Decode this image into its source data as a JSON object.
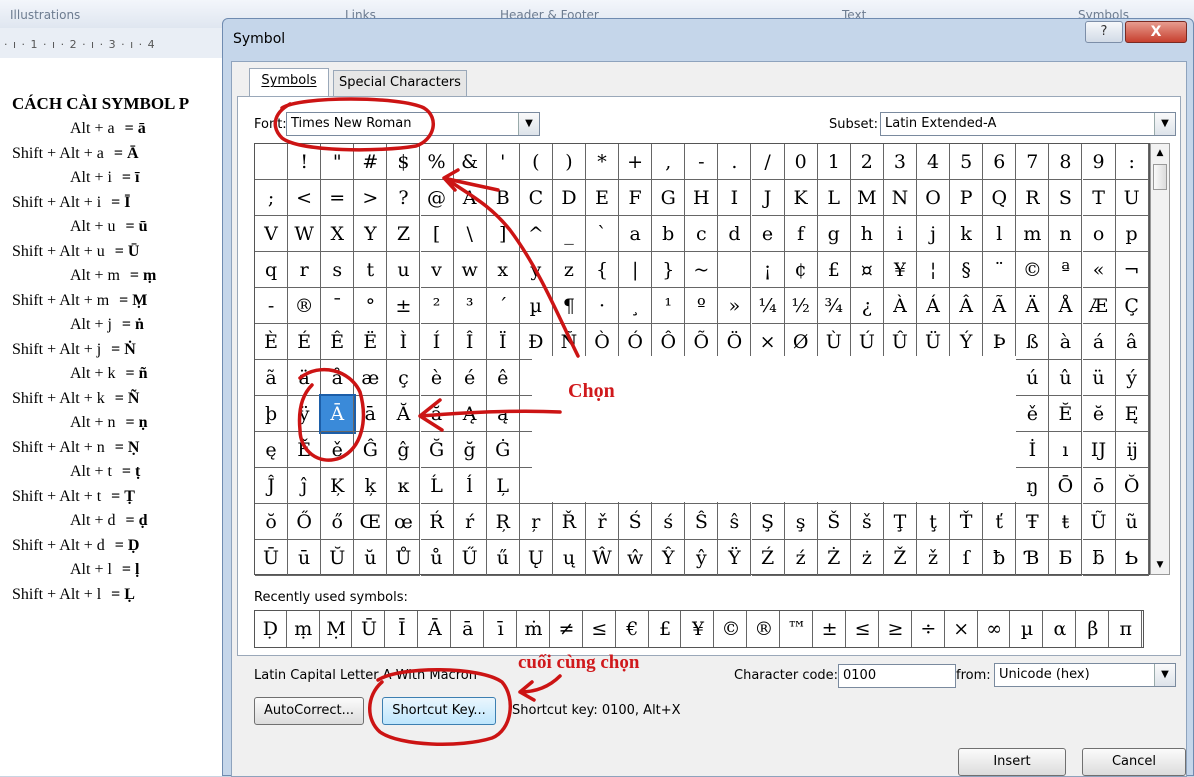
{
  "background": {
    "ribbon_groups": [
      "Illustrations",
      "Links",
      "Header & Footer",
      "Text",
      "Symbols"
    ],
    "ruler_text": "· ı · 1 · ı · 2 · ı · 3 · ı · 4",
    "doc_title": "CÁCH CÀI SYMBOL P",
    "doc_lines": [
      {
        "keys": "Alt + a",
        "sym": "= ā"
      },
      {
        "keys": "Shift + Alt + a",
        "sym": "= Ā"
      },
      {
        "keys": "Alt + i",
        "sym": "= ī"
      },
      {
        "keys": "Shift + Alt + i",
        "sym": "= Ī"
      },
      {
        "keys": "Alt + u",
        "sym": "= ū"
      },
      {
        "keys": "Shift + Alt + u",
        "sym": "= Ū"
      },
      {
        "keys": "Alt + m",
        "sym": "= ṃ"
      },
      {
        "keys": "Shift + Alt + m",
        "sym": "= Ṃ"
      },
      {
        "keys": "Alt + j",
        "sym": "= ṅ"
      },
      {
        "keys": "Shift + Alt + j",
        "sym": "= Ṅ"
      },
      {
        "keys": "Alt + k",
        "sym": "= ñ"
      },
      {
        "keys": "Shift + Alt + k",
        "sym": "= Ñ"
      },
      {
        "keys": "Alt + n",
        "sym": "= ṇ"
      },
      {
        "keys": "Shift + Alt + n",
        "sym": "= Ṇ"
      },
      {
        "keys": "Alt + t",
        "sym": "= ṭ"
      },
      {
        "keys": "Shift + Alt + t",
        "sym": "= Ṭ"
      },
      {
        "keys": "Alt + d",
        "sym": "= ḍ"
      },
      {
        "keys": "Shift + Alt + d",
        "sym": "= Ḍ"
      },
      {
        "keys": "Alt + l",
        "sym": "= ḷ"
      },
      {
        "keys": "Shift + Alt + l",
        "sym": "= Ḷ"
      }
    ]
  },
  "dialog": {
    "title": "Symbol",
    "help_label": "?",
    "close_label": "X",
    "tabs": [
      "Symbols",
      "Special Characters"
    ],
    "font_label": "Font:",
    "font_value": "Times New Roman",
    "subset_label": "Subset:",
    "subset_value": "Latin Extended-A",
    "grid_rows": [
      [
        " ",
        "!",
        "\"",
        "#",
        "$",
        "%",
        "&",
        "'",
        "(",
        ")",
        "*",
        "+",
        ",",
        "-",
        ".",
        "/",
        "0",
        "1",
        "2",
        "3",
        "4",
        "5",
        "6",
        "7",
        "8",
        "9",
        ":"
      ],
      [
        ";",
        "<",
        "=",
        ">",
        "?",
        "@",
        "A",
        "B",
        "C",
        "D",
        "E",
        "F",
        "G",
        "H",
        "I",
        "J",
        "K",
        "L",
        "M",
        "N",
        "O",
        "P",
        "Q",
        "R",
        "S",
        "T",
        "U"
      ],
      [
        "V",
        "W",
        "X",
        "Y",
        "Z",
        "[",
        "\\",
        "]",
        "^",
        "_",
        "`",
        "a",
        "b",
        "c",
        "d",
        "e",
        "f",
        "g",
        "h",
        "i",
        "j",
        "k",
        "l",
        "m",
        "n",
        "o",
        "p"
      ],
      [
        "q",
        "r",
        "s",
        "t",
        "u",
        "v",
        "w",
        "x",
        "y",
        "z",
        "{",
        "|",
        "}",
        "~",
        " ",
        "¡",
        "¢",
        "£",
        "¤",
        "¥",
        "¦",
        "§",
        "¨",
        "©",
        "ª",
        "«",
        "¬"
      ],
      [
        "-",
        "®",
        "¯",
        "°",
        "±",
        "²",
        "³",
        "´",
        "µ",
        "¶",
        "·",
        "¸",
        "¹",
        "º",
        "»",
        "¼",
        "½",
        "¾",
        "¿",
        "À",
        "Á",
        "Â",
        "Ã",
        "Ä",
        "Å",
        "Æ",
        "Ç"
      ],
      [
        "È",
        "É",
        "Ê",
        "Ë",
        "Ì",
        "Í",
        "Î",
        "Ï",
        "Ð",
        "Ñ",
        "Ò",
        "Ó",
        "Ô",
        "Õ",
        "Ö",
        "×",
        "Ø",
        "Ù",
        "Ú",
        "Û",
        "Ü",
        "Ý",
        "Þ",
        "ß",
        "à",
        "á",
        "â"
      ],
      [
        "ã",
        "ä",
        "å",
        "æ",
        "ç",
        "è",
        "é",
        "ê",
        "",
        "",
        "",
        "",
        "",
        "",
        "",
        "",
        "",
        "",
        "",
        "",
        "",
        "",
        "",
        "ú",
        "û",
        "ü",
        "ý"
      ],
      [
        "þ",
        "ÿ",
        "Ā",
        "ā",
        "Ă",
        "ă",
        "Ą",
        "ą",
        "",
        "",
        "",
        "",
        "",
        "",
        "",
        "",
        "",
        "",
        "",
        "",
        "",
        "",
        "",
        "ě",
        "Ĕ",
        "ĕ",
        "Ę"
      ],
      [
        "ę",
        "Ě",
        "ě",
        "Ĝ",
        "ĝ",
        "Ğ",
        "ğ",
        "Ġ",
        "",
        "",
        "",
        "",
        "",
        "",
        "",
        "",
        "",
        "",
        "",
        "",
        "",
        "",
        "",
        "İ",
        "ı",
        "Ĳ",
        "ĳ"
      ],
      [
        "Ĵ",
        "ĵ",
        "Ķ",
        "ķ",
        "ĸ",
        "Ĺ",
        "ĺ",
        "Ļ",
        "",
        "",
        "",
        "",
        "",
        "",
        "",
        "",
        "",
        "",
        "",
        "",
        "",
        "",
        "",
        "ŋ",
        "Ō",
        "ō",
        "Ŏ"
      ],
      [
        "ŏ",
        "Ő",
        "ő",
        "Œ",
        "œ",
        "Ŕ",
        "ŕ",
        "Ŗ",
        "ŗ",
        "Ř",
        "ř",
        "Ś",
        "ś",
        "Ŝ",
        "ŝ",
        "Ş",
        "ş",
        "Š",
        "š",
        "Ţ",
        "ţ",
        "Ť",
        "ť",
        "Ŧ",
        "ŧ",
        "Ũ",
        "ũ"
      ],
      [
        "Ū",
        "ū",
        "Ŭ",
        "ŭ",
        "Ů",
        "ů",
        "Ű",
        "ű",
        "Ų",
        "ų",
        "Ŵ",
        "ŵ",
        "Ŷ",
        "ŷ",
        "Ÿ",
        "Ź",
        "ź",
        "Ż",
        "ż",
        "Ž",
        "ž",
        "ſ",
        "ƀ",
        "Ɓ",
        "Ƃ",
        "ƃ",
        "Ƅ"
      ]
    ],
    "selected_char": "Ā",
    "recent_label": "Recently used symbols:",
    "recent_symbols": [
      "Ḍ",
      "ṃ",
      "Ṃ",
      "Ū",
      "Ī",
      "Ā",
      "ā",
      "ī",
      "ṁ",
      "≠",
      "≤",
      "€",
      "£",
      "¥",
      "©",
      "®",
      "™",
      "±",
      "≤",
      "≥",
      "÷",
      "×",
      "∞",
      "µ",
      "α",
      "β",
      "π"
    ],
    "char_name": "Latin Capital Letter A With Macron",
    "char_code_label": "Character code:",
    "char_code_value": "0100",
    "from_label": "from:",
    "from_value": "Unicode (hex)",
    "autocorrect_label": "AutoCorrect...",
    "shortcut_key_button": "Shortcut Key...",
    "shortcut_key_text": "Shortcut key: 0100, Alt+X",
    "insert_label": "Insert",
    "cancel_label": "Cancel"
  },
  "annotations": {
    "choose_label": "Chọn",
    "final_label": "cuối cùng chọn",
    "color": "#d0191c"
  }
}
